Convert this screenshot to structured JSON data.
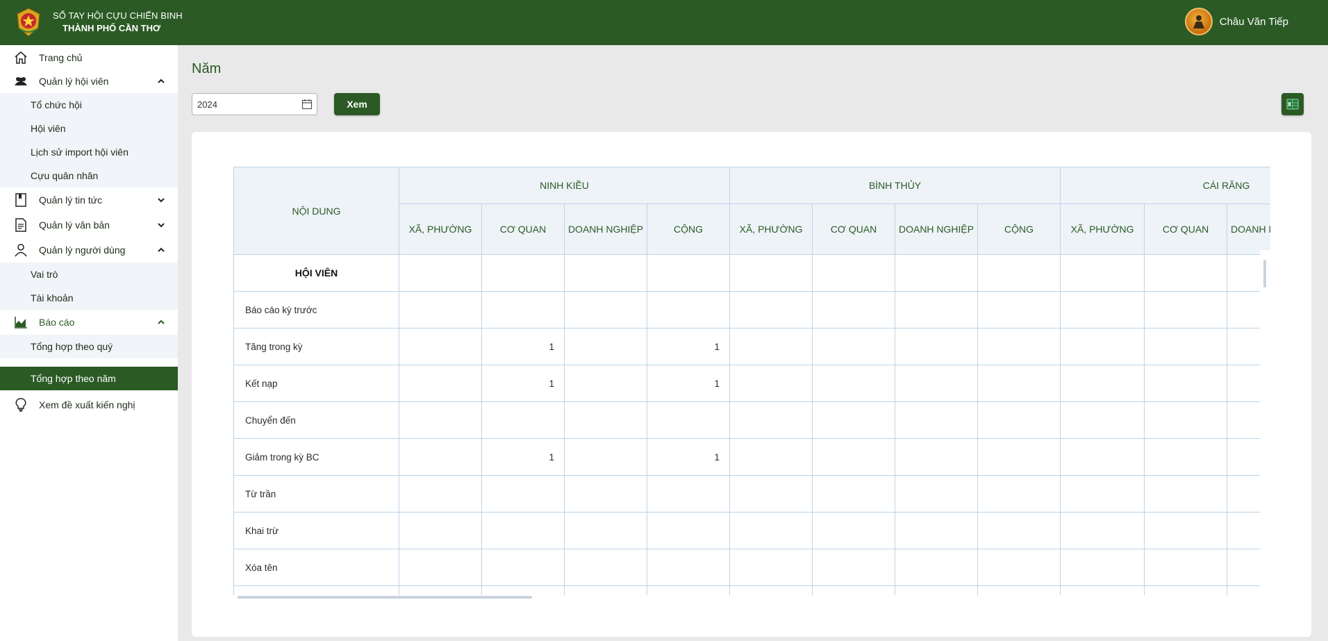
{
  "header": {
    "brand_line1": "SỔ TAY HỘI CỰU CHIẾN BINH",
    "brand_line2": "THÀNH PHỐ CẦN THƠ",
    "user_name": "Châu Văn Tiếp",
    "bg_color": "#2b5a25"
  },
  "sidebar": {
    "items": [
      {
        "label": "Trang chủ",
        "icon": "home-icon"
      },
      {
        "label": "Quản lý hội viên",
        "icon": "users-icon"
      },
      {
        "label": "Tổ chức hội"
      },
      {
        "label": "Hội viên"
      },
      {
        "label": "Lịch sử import hội viên"
      },
      {
        "label": "Cựu quân nhân"
      },
      {
        "label": "Quản lý tin tức",
        "icon": "bookmark-icon"
      },
      {
        "label": "Quản lý văn bản",
        "icon": "document-icon"
      },
      {
        "label": "Quản lý người dùng",
        "icon": "user-icon"
      },
      {
        "label": "Vai trò"
      },
      {
        "label": "Tài khoản"
      },
      {
        "label": "Báo cáo",
        "icon": "chart-icon"
      },
      {
        "label": "Tổng hợp theo quý"
      },
      {
        "label": "Tổng hợp theo năm"
      },
      {
        "label": "Xem đề xuất kiến nghị",
        "icon": "lightbulb-icon"
      }
    ]
  },
  "main": {
    "title": "Năm",
    "year_value": "2024",
    "view_button": "Xem",
    "excel_icon": "excel-export-icon"
  },
  "table": {
    "first_header": "NỘI DUNG",
    "districts": [
      "NINH KIỀU",
      "BÌNH THỦY",
      "CÁI RĂNG"
    ],
    "sub_headers": [
      "XÃ, PHƯỜNG",
      "CƠ QUAN",
      "DOANH NGHIỆP",
      "CỘNG"
    ],
    "rows": [
      {
        "label": "HỘI VIÊN",
        "section": true,
        "values": [
          "",
          "",
          "",
          "",
          "",
          "",
          "",
          "",
          "",
          "",
          "",
          ""
        ]
      },
      {
        "label": "Báo cáo kỳ trước",
        "values": [
          "",
          "",
          "",
          "",
          "",
          "",
          "",
          "",
          "",
          "",
          "",
          ""
        ]
      },
      {
        "label": "Tăng trong kỳ",
        "values": [
          "",
          "1",
          "",
          "1",
          "",
          "",
          "",
          "",
          "",
          "",
          "",
          ""
        ]
      },
      {
        "label": "Kết nạp",
        "values": [
          "",
          "1",
          "",
          "1",
          "",
          "",
          "",
          "",
          "",
          "",
          "",
          ""
        ]
      },
      {
        "label": "Chuyển đến",
        "values": [
          "",
          "",
          "",
          "",
          "",
          "",
          "",
          "",
          "",
          "",
          "",
          ""
        ]
      },
      {
        "label": "Giảm trong kỳ BC",
        "values": [
          "",
          "1",
          "",
          "1",
          "",
          "",
          "",
          "",
          "",
          "",
          "",
          ""
        ]
      },
      {
        "label": "Từ trần",
        "values": [
          "",
          "",
          "",
          "",
          "",
          "",
          "",
          "",
          "",
          "",
          "",
          ""
        ]
      },
      {
        "label": "Khai trừ",
        "values": [
          "",
          "",
          "",
          "",
          "",
          "",
          "",
          "",
          "",
          "",
          "",
          ""
        ]
      },
      {
        "label": "Xóa tên",
        "values": [
          "",
          "",
          "",
          "",
          "",
          "",
          "",
          "",
          "",
          "",
          "",
          ""
        ]
      },
      {
        "label": "",
        "values": [
          "",
          "",
          "",
          "",
          "",
          "",
          "",
          "",
          "",
          "",
          "",
          ""
        ]
      }
    ]
  }
}
